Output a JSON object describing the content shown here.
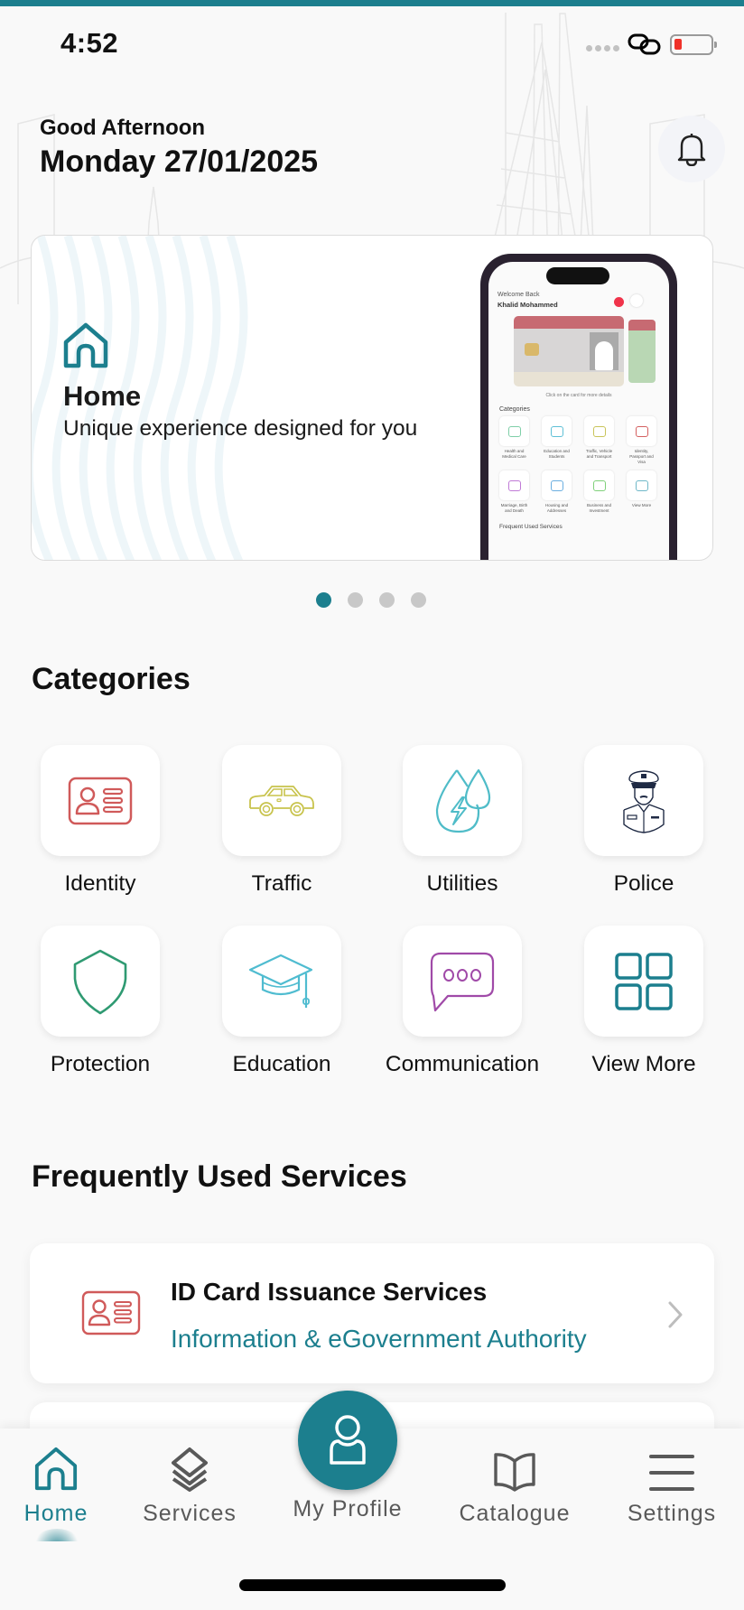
{
  "status_bar": {
    "time": "4:52",
    "icons": [
      "signal-dots-icon",
      "link-icon",
      "battery-low-icon"
    ],
    "battery_color": "#f0322a"
  },
  "header": {
    "greeting": "Good Afternoon",
    "date": "Monday 27/01/2025",
    "notification_icon": "bell-icon"
  },
  "banner": {
    "icon": "home-icon",
    "title": "Home",
    "subtitle": "Unique experience designed for you",
    "phone_preview": {
      "welcome": "Welcome Back",
      "user_name": "Khalid Mohammed",
      "card_hint": "Click on the card for more details",
      "categories_title": "Categories",
      "categories": [
        {
          "label": "Health and Medical Care",
          "color": "#7fcfa8"
        },
        {
          "label": "Education and Students",
          "color": "#5fc0d6"
        },
        {
          "label": "Traffic, Vehicle and Transport",
          "color": "#c9c45a"
        },
        {
          "label": "Identity, Passport and Visa",
          "color": "#d46060"
        },
        {
          "label": "Marriage, Birth and Death",
          "color": "#c07ad6"
        },
        {
          "label": "Housing and Addresses",
          "color": "#6aaee0"
        },
        {
          "label": "Business and Investment",
          "color": "#7fd07a"
        },
        {
          "label": "View More",
          "color": "#6fb8c8"
        }
      ],
      "frequent_title": "Frequent Used Services"
    },
    "pagination": {
      "total": 4,
      "active_index": 0
    }
  },
  "categories": {
    "title": "Categories",
    "items": [
      {
        "label": "Identity",
        "icon": "id-card-icon",
        "color": "#d05a5a"
      },
      {
        "label": "Traffic",
        "icon": "car-icon",
        "color": "#c8c34c"
      },
      {
        "label": "Utilities",
        "icon": "water-electricity-icon",
        "color": "#4fbcc8"
      },
      {
        "label": "Police",
        "icon": "police-officer-icon",
        "color": "#1f2a44"
      },
      {
        "label": "Protection",
        "icon": "shield-icon",
        "color": "#2f9a72"
      },
      {
        "label": "Education",
        "icon": "graduation-cap-icon",
        "color": "#4fbcd0"
      },
      {
        "label": "Communication",
        "icon": "chat-bubble-icon",
        "color": "#a04aa8"
      },
      {
        "label": "View More",
        "icon": "grid-icon",
        "color": "#1c7f8e"
      }
    ]
  },
  "frequent_services": {
    "title": "Frequently Used Services",
    "items": [
      {
        "title": "ID Card Issuance Services",
        "organization": "Information & eGovernment Authority",
        "icon": "id-card-icon"
      }
    ]
  },
  "bottom_nav": {
    "items": [
      {
        "label": "Home",
        "icon": "home-icon",
        "active": true
      },
      {
        "label": "Services",
        "icon": "layers-icon",
        "active": false
      },
      {
        "label": "My Profile",
        "icon": "user-icon",
        "active": false
      },
      {
        "label": "Catalogue",
        "icon": "book-icon",
        "active": false
      },
      {
        "label": "Settings",
        "icon": "menu-icon",
        "active": false
      }
    ]
  },
  "theme": {
    "accent": "#1c7f8e",
    "background": "#f9f9f9",
    "inactive_dot": "#c8c8c8",
    "nav_inactive": "#595959"
  }
}
